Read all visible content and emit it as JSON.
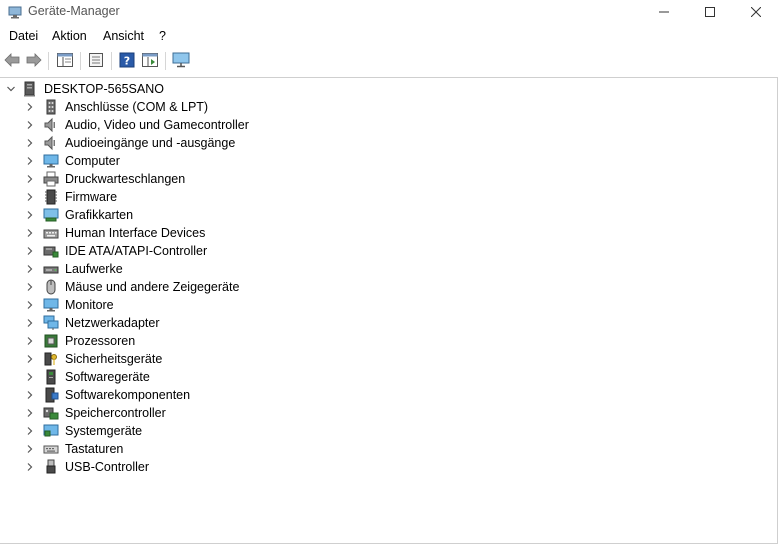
{
  "window": {
    "title": "Geräte-Manager",
    "controls": [
      "minimize-icon",
      "maximize-icon",
      "close-icon"
    ]
  },
  "menu": {
    "items": [
      "Datei",
      "Aktion",
      "Ansicht",
      "?"
    ]
  },
  "toolbar": {
    "buttons": [
      "back-arrow-icon",
      "forward-arrow-icon",
      "show-hide-console-tree-icon",
      "properties-icon",
      "help-icon",
      "run-action-icon",
      "display-monitor-icon"
    ]
  },
  "tree": {
    "root": {
      "label": "DESKTOP-565SANO",
      "expanded": true,
      "icon": "computer-tower-icon"
    },
    "categories": [
      {
        "label": "Anschlüsse (COM & LPT)",
        "icon": "port-icon"
      },
      {
        "label": "Audio, Video und Gamecontroller",
        "icon": "speaker-icon"
      },
      {
        "label": "Audioeingänge und -ausgänge",
        "icon": "speaker-icon"
      },
      {
        "label": "Computer",
        "icon": "monitor-icon"
      },
      {
        "label": "Druckwarteschlangen",
        "icon": "printer-icon"
      },
      {
        "label": "Firmware",
        "icon": "chip-icon"
      },
      {
        "label": "Grafikkarten",
        "icon": "display-adapter-icon"
      },
      {
        "label": "Human Interface Devices",
        "icon": "keyboard-hid-icon"
      },
      {
        "label": "IDE ATA/ATAPI-Controller",
        "icon": "ide-controller-icon"
      },
      {
        "label": "Laufwerke",
        "icon": "disk-drive-icon"
      },
      {
        "label": "Mäuse und andere Zeigegeräte",
        "icon": "mouse-icon"
      },
      {
        "label": "Monitore",
        "icon": "monitor-icon"
      },
      {
        "label": "Netzwerkadapter",
        "icon": "network-adapter-icon"
      },
      {
        "label": "Prozessoren",
        "icon": "processor-icon"
      },
      {
        "label": "Sicherheitsgeräte",
        "icon": "security-key-icon"
      },
      {
        "label": "Softwaregeräte",
        "icon": "software-device-icon"
      },
      {
        "label": "Softwarekomponenten",
        "icon": "software-component-icon"
      },
      {
        "label": "Speichercontroller",
        "icon": "storage-controller-icon"
      },
      {
        "label": "Systemgeräte",
        "icon": "system-devices-icon"
      },
      {
        "label": "Tastaturen",
        "icon": "keyboard-icon"
      },
      {
        "label": "USB-Controller",
        "icon": "usb-icon"
      }
    ]
  },
  "colors": {
    "title_text": "#555555",
    "tree_border": "#cfcfcf",
    "chevron": "#555555",
    "help_blue": "#2a5aa8"
  }
}
